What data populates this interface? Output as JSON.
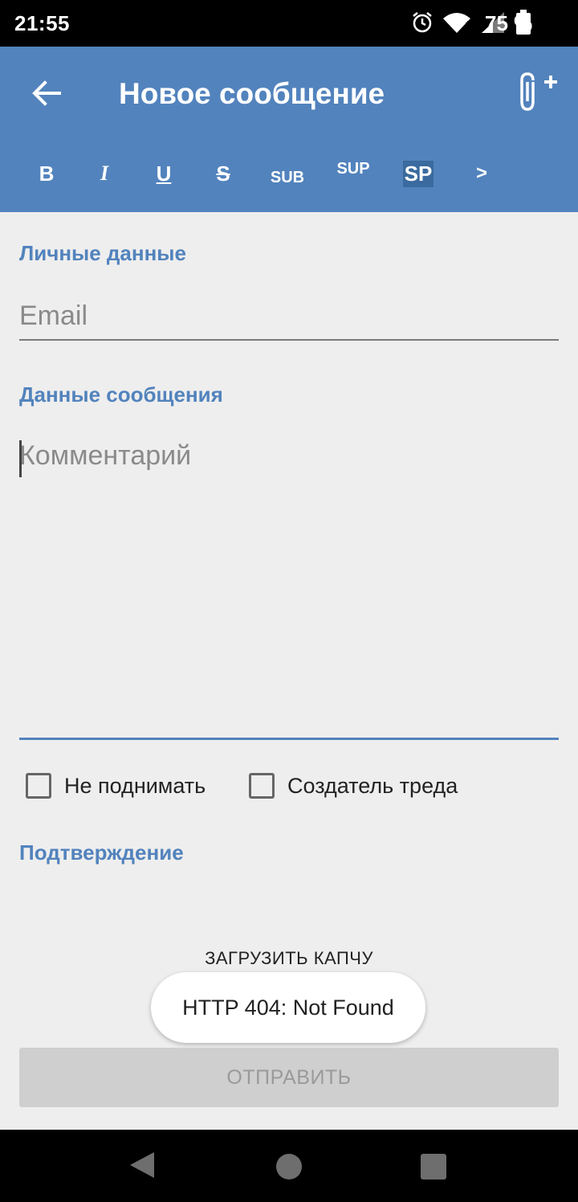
{
  "status_bar": {
    "time": "21:55",
    "battery_percent": "75 %",
    "icons": [
      "alarm-icon",
      "wifi-icon",
      "signal-icon",
      "battery-icon"
    ]
  },
  "app_bar": {
    "title": "Новое сообщение",
    "back_icon": "arrow-left-icon",
    "attach_icon": "paperclip-plus-icon",
    "background_color": "#5283bd"
  },
  "format_toolbar": {
    "bold": "B",
    "italic": "I",
    "underline": "U",
    "strike": "S",
    "sub": "SUB",
    "sup": "SUP",
    "spoiler": "SP",
    "more": ">"
  },
  "form": {
    "personal_section": "Личные данные",
    "email_placeholder": "Email",
    "message_section": "Данные сообщения",
    "comment_placeholder": "Комментарий",
    "checkbox_no_bump": "Не поднимать",
    "checkbox_op": "Создатель треда",
    "confirm_section": "Подтверждение",
    "load_captcha": "ЗАГРУЗИТЬ КАПЧУ",
    "submit": "ОТПРАВИТЬ"
  },
  "toast": {
    "message": "HTTP 404: Not Found"
  },
  "nav_bar": {
    "icons": [
      "nav-back-icon",
      "nav-home-icon",
      "nav-recents-icon"
    ]
  }
}
